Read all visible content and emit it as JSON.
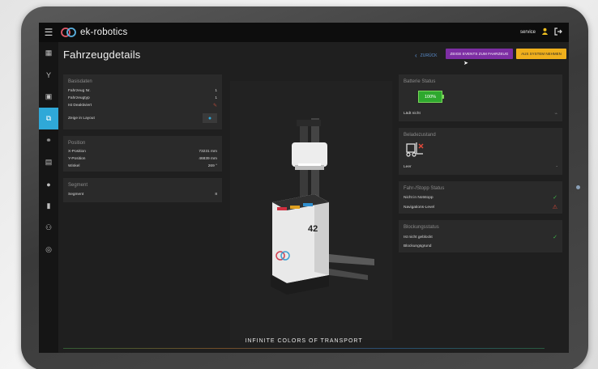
{
  "topbar": {
    "logo_text": "ek-robotics",
    "user": "service",
    "icons": {
      "menu": "hamburger-icon",
      "user": "user-icon",
      "logout": "logout-icon"
    }
  },
  "sidebar": {
    "items": [
      {
        "icon": "dashboard-icon"
      },
      {
        "icon": "branch-icon"
      },
      {
        "icon": "clipboard-icon"
      },
      {
        "icon": "vehicles-icon",
        "active": true
      },
      {
        "icon": "transport-icon"
      },
      {
        "icon": "layout-icon"
      },
      {
        "icon": "location-icon"
      },
      {
        "icon": "bookmark-icon"
      },
      {
        "icon": "users-icon"
      },
      {
        "icon": "settings-icon"
      }
    ]
  },
  "header": {
    "title": "Fahrzeugdetails",
    "back_label": "ZURÜCK",
    "events_button": "ZEIGE EVENTS ZUM FAHRZEUG",
    "system_button": "AUS SYSTEM NEHMEN"
  },
  "basisdaten": {
    "title": "Basisdaten",
    "rows": [
      {
        "label": "Fahrzeug Nr.",
        "value": "1"
      },
      {
        "label": "Fahrzeugtyp",
        "value": "1"
      },
      {
        "label": "Ist Deaktiviert",
        "value": ""
      }
    ],
    "layout_label": "Zeige in Layout"
  },
  "position": {
    "title": "Position",
    "rows": [
      {
        "label": "X-Position",
        "value": "73231 mm"
      },
      {
        "label": "Y-Position",
        "value": "46839 mm"
      },
      {
        "label": "Winkel",
        "value": "269 °"
      }
    ]
  },
  "segment": {
    "title": "Segment",
    "label": "Segment",
    "value": "8"
  },
  "robot": {
    "number": "42",
    "brand": "ek-robotics"
  },
  "batterie": {
    "title": "Batterie Status",
    "percent": "100%",
    "charging": "Lädt nicht"
  },
  "beladezustand": {
    "title": "Beladezustand",
    "label": "Leer",
    "value": "-"
  },
  "fahr_stopp": {
    "title": "Fahr-/Stopp Status",
    "rows": [
      {
        "label": "Nicht in Notstopp"
      },
      {
        "label": "Navigations-Level"
      }
    ]
  },
  "blockung": {
    "title": "Blockungsstatus",
    "rows": [
      {
        "label": "Ist nicht geblockt"
      },
      {
        "label": "Blockungsgrund"
      }
    ]
  },
  "footer": {
    "tagline": "INFINITE COLORS OF TRANSPORT"
  },
  "colors": {
    "accent_blue": "#2fa8d8",
    "purple": "#7d2ea3",
    "yellow": "#f0b01c",
    "green": "#2ea82e"
  }
}
